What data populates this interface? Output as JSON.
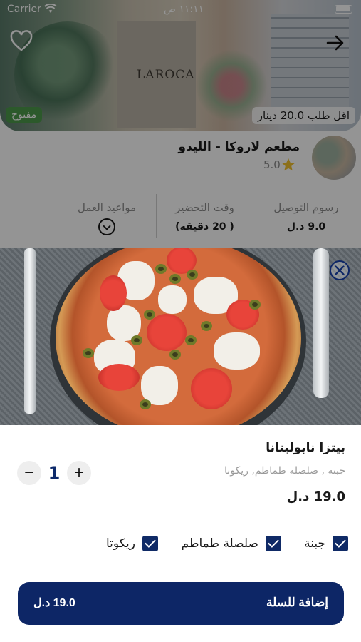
{
  "status_bar": {
    "carrier": "Carrier",
    "time": "١١:١١ ص"
  },
  "restaurant": {
    "open_badge": "مفتوح",
    "min_order": "اقل طلب 20.0 دينار",
    "name": "مطعم لاروكا - الليدو",
    "rating": "5.0",
    "logo_text": "LAROCA",
    "info": {
      "delivery_label": "رسوم التوصيل",
      "delivery_value": "9.0 د.ل",
      "prep_label": "وقت التحضير",
      "prep_value": "( 20  دقيقة)",
      "hours_label": "مواعيد العمل"
    }
  },
  "item": {
    "title": "بيتزا نابوليتانا",
    "description": "جبنة , صلصلة طماطم, ريكوتا",
    "price": "19.0 د.ل",
    "quantity": "1",
    "addons": [
      {
        "label": "جبنة",
        "checked": true
      },
      {
        "label": "صلصلة طماطم",
        "checked": true
      },
      {
        "label": "ريكوتا",
        "checked": true
      }
    ]
  },
  "cart_button": {
    "label": "إضافة للسلة",
    "price": "19.0 د.ل"
  },
  "icons": {
    "heart": "heart-icon",
    "back": "arrow-right-icon",
    "star": "star-icon",
    "close": "close-icon",
    "chevron": "chevron-down-icon",
    "wifi": "wifi-icon",
    "battery": "battery-icon"
  },
  "colors": {
    "primary": "#0d2666",
    "open": "#4c9a4a",
    "star": "#f2c230"
  }
}
